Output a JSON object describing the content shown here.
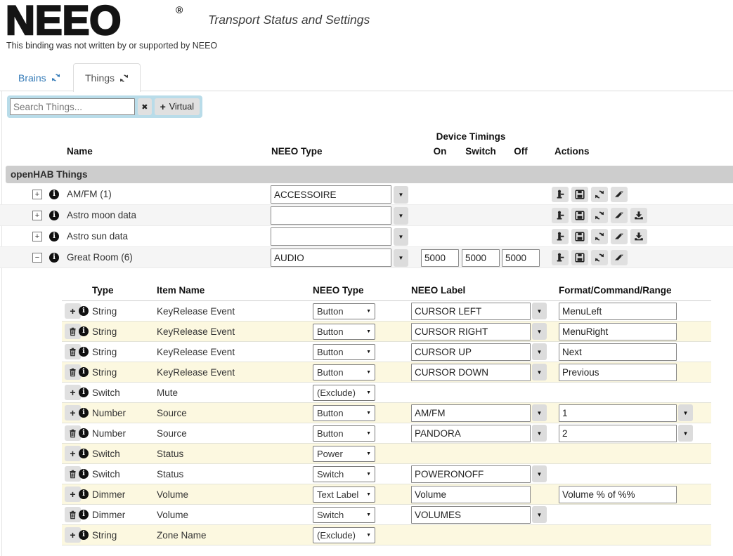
{
  "header": {
    "logo": "NEEO",
    "registered": "®",
    "title": "Transport Status and Settings",
    "disclaimer": "This binding was not written by or supported by NEEO"
  },
  "tabs": {
    "brains": {
      "label": "Brains",
      "active": false
    },
    "things": {
      "label": "Things",
      "active": true
    }
  },
  "search": {
    "placeholder": "Search Things...",
    "clear_label": "✖",
    "virtual_label": "Virtual"
  },
  "things_table": {
    "group_label": "openHAB Things",
    "headers": {
      "name": "Name",
      "neeo_type": "NEEO Type",
      "device_timings": "Device Timings",
      "on": "On",
      "switch": "Switch",
      "off": "Off",
      "actions": "Actions"
    },
    "rows": [
      {
        "name": "AM/FM (1)",
        "expanded": false,
        "neeo_type": "ACCESSOIRE",
        "timings": null,
        "actions": [
          "hydrant",
          "save",
          "refresh",
          "eraser"
        ]
      },
      {
        "name": "Astro moon data",
        "expanded": false,
        "neeo_type": "",
        "timings": null,
        "actions": [
          "hydrant",
          "save",
          "refresh",
          "eraser",
          "download"
        ]
      },
      {
        "name": "Astro sun data",
        "expanded": false,
        "neeo_type": "",
        "timings": null,
        "actions": [
          "hydrant",
          "save",
          "refresh",
          "eraser",
          "download"
        ]
      },
      {
        "name": "Great Room (6)",
        "expanded": true,
        "neeo_type": "AUDIO",
        "timings": {
          "on": "5000",
          "switch": "5000",
          "off": "5000"
        },
        "actions": [
          "hydrant",
          "save",
          "refresh",
          "eraser"
        ]
      }
    ]
  },
  "items_table": {
    "headers": {
      "type": "Type",
      "item_name": "Item Name",
      "neeo_type": "NEEO Type",
      "neeo_label": "NEEO Label",
      "format": "Format/Command/Range"
    },
    "rows": [
      {
        "action": "add",
        "type": "String",
        "item_name": "KeyRelease Event",
        "neeo_type": "Button",
        "label": {
          "value": "CURSOR LEFT",
          "caret": true
        },
        "format": {
          "value": "MenuLeft",
          "caret": false
        }
      },
      {
        "action": "delete",
        "type": "String",
        "item_name": "KeyRelease Event",
        "neeo_type": "Button",
        "label": {
          "value": "CURSOR RIGHT",
          "caret": true
        },
        "format": {
          "value": "MenuRight",
          "caret": false
        }
      },
      {
        "action": "delete",
        "type": "String",
        "item_name": "KeyRelease Event",
        "neeo_type": "Button",
        "label": {
          "value": "CURSOR UP",
          "caret": true
        },
        "format": {
          "value": "Next",
          "caret": false
        }
      },
      {
        "action": "delete",
        "type": "String",
        "item_name": "KeyRelease Event",
        "neeo_type": "Button",
        "label": {
          "value": "CURSOR DOWN",
          "caret": true
        },
        "format": {
          "value": "Previous",
          "caret": false
        }
      },
      {
        "action": "add",
        "type": "Switch",
        "item_name": "Mute",
        "neeo_type": "(Exclude)",
        "label": null,
        "format": null
      },
      {
        "action": "add",
        "type": "Number",
        "item_name": "Source",
        "neeo_type": "Button",
        "label": {
          "value": "AM/FM",
          "caret": true
        },
        "format": {
          "value": "1",
          "caret": true
        }
      },
      {
        "action": "delete",
        "type": "Number",
        "item_name": "Source",
        "neeo_type": "Button",
        "label": {
          "value": "PANDORA",
          "caret": true
        },
        "format": {
          "value": "2",
          "caret": true
        }
      },
      {
        "action": "add",
        "type": "Switch",
        "item_name": "Status",
        "neeo_type": "Power",
        "label": null,
        "format": null
      },
      {
        "action": "delete",
        "type": "Switch",
        "item_name": "Status",
        "neeo_type": "Switch",
        "label": {
          "value": "POWERONOFF",
          "caret": true
        },
        "format": null
      },
      {
        "action": "add",
        "type": "Dimmer",
        "item_name": "Volume",
        "neeo_type": "Text Label",
        "label": {
          "value": "Volume",
          "caret": false
        },
        "format": {
          "value": "Volume % of %%",
          "caret": false
        }
      },
      {
        "action": "delete",
        "type": "Dimmer",
        "item_name": "Volume",
        "neeo_type": "Switch",
        "label": {
          "value": "VOLUMES",
          "caret": true
        },
        "format": null
      },
      {
        "action": "add",
        "type": "String",
        "item_name": "Zone Name",
        "neeo_type": "(Exclude)",
        "label": null,
        "format": null
      }
    ]
  },
  "colors": {
    "link_blue": "#337ab7",
    "search_well_bg": "#b9dce9",
    "row_stripe": "#f5f5f5",
    "row_yellow": "#fcf8e0",
    "group_row_bg": "#cdcdcd",
    "button_bg": "#e0e0e0",
    "border": "#dddddd",
    "input_border": "#8a8a8a"
  }
}
